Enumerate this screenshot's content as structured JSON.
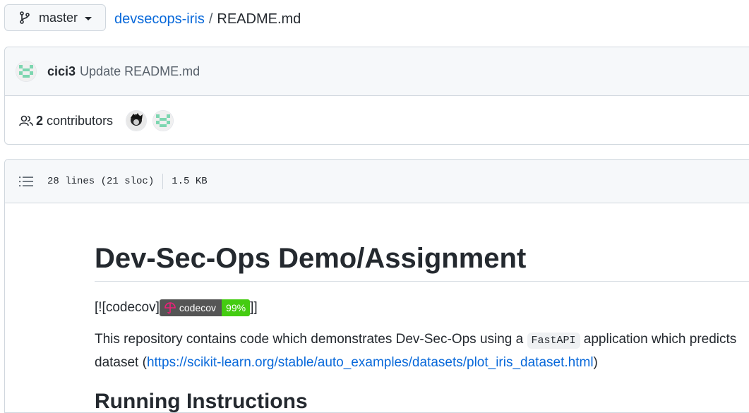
{
  "branch": {
    "name": "master"
  },
  "breadcrumb": {
    "repo": "devsecops-iris",
    "separator": "/",
    "file": "README.md"
  },
  "commit": {
    "author": "cici3",
    "message": "Update README.md"
  },
  "contributors": {
    "count": "2",
    "label": "contributors"
  },
  "file_info": {
    "lines": "28 lines (21 sloc)",
    "size": "1.5 KB"
  },
  "readme": {
    "title": "Dev-Sec-Ops Demo/Assignment",
    "badge_prefix": "[![codecov]",
    "badge_suffix": "]]",
    "badge_name": "codecov",
    "badge_value": "99%",
    "intro_before": "This repository contains code which demonstrates Dev-Sec-Ops using a ",
    "intro_code": "FastAPI",
    "intro_after": " application which predicts",
    "intro_line2_before": "dataset (",
    "intro_link": "https://scikit-learn.org/stable/auto_examples/datasets/plot_iris_dataset.html",
    "intro_line2_after": ")",
    "next_heading": "Running Instructions"
  },
  "colors": {
    "link": "#0969da",
    "badge_green": "#4c1",
    "badge_gray": "#555"
  }
}
